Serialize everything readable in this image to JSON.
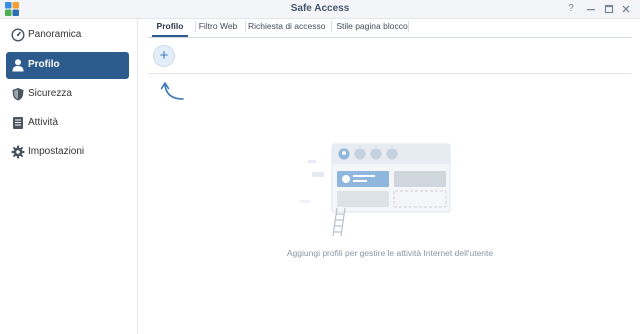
{
  "window": {
    "title": "Safe Access",
    "controls": [
      "help-icon",
      "minimize-icon",
      "maximize-icon",
      "close-icon"
    ]
  },
  "sidebar": {
    "items": [
      {
        "label": "Panoramica",
        "icon": "dashboard-icon",
        "active": false
      },
      {
        "label": "Profilo",
        "icon": "user-icon",
        "active": true
      },
      {
        "label": "Sicurezza",
        "icon": "shield-icon",
        "active": false
      },
      {
        "label": "Attività",
        "icon": "activity-log-icon",
        "active": false
      },
      {
        "label": "Impostazioni",
        "icon": "gear-icon",
        "active": false
      }
    ]
  },
  "tabs": [
    {
      "label": "Profilo",
      "active": true
    },
    {
      "label": "Filtro Web",
      "active": false
    },
    {
      "label": "Richiesta di accesso",
      "active": false
    },
    {
      "label": "Stile pagina blocco",
      "active": false
    }
  ],
  "toolbar": {
    "add_label": "+"
  },
  "empty_state": {
    "message": "Aggiungi profili per gestire le attività Internet dell'utente"
  },
  "colors": {
    "accent": "#2e5b8e",
    "add_button": "#3a78b8",
    "muted_text": "#8a96a3"
  }
}
